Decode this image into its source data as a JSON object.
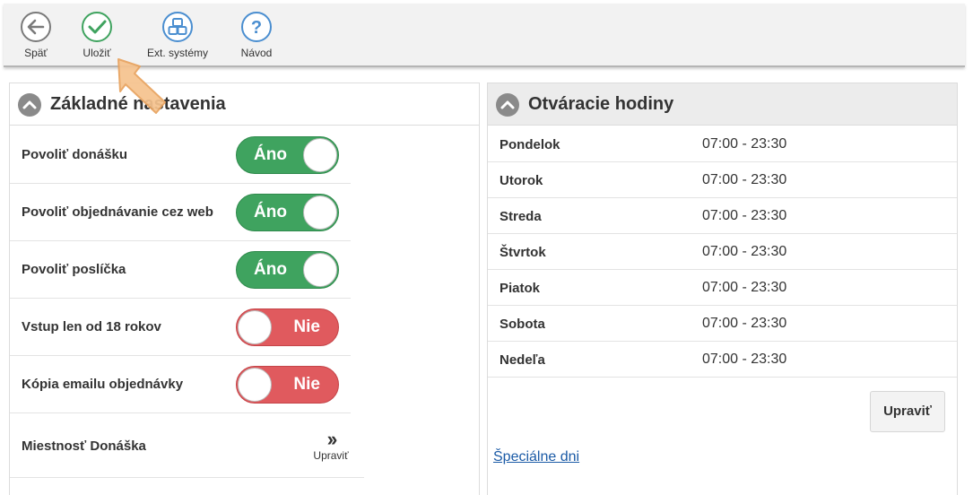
{
  "toolbar": {
    "back_label": "Späť",
    "save_label": "Uložiť",
    "ext_label": "Ext. systémy",
    "help_label": "Návod"
  },
  "left_panel": {
    "title": "Základné nastavenia",
    "settings": [
      {
        "label": "Povoliť donášku",
        "state": "Áno",
        "on": true
      },
      {
        "label": "Povoliť objednávanie cez web",
        "state": "Áno",
        "on": true
      },
      {
        "label": "Povoliť poslíčka",
        "state": "Áno",
        "on": true
      },
      {
        "label": "Vstup len od 18 rokov",
        "state": "Nie",
        "on": false
      },
      {
        "label": "Kópia emailu objednávky",
        "state": "Nie",
        "on": false
      }
    ],
    "room": {
      "label": "Miestnosť Donáška",
      "edit_label": "Upraviť"
    }
  },
  "right_panel": {
    "title": "Otváracie hodiny",
    "hours": [
      {
        "day": "Pondelok",
        "time": "07:00 - 23:30"
      },
      {
        "day": "Utorok",
        "time": "07:00 - 23:30"
      },
      {
        "day": "Streda",
        "time": "07:00 - 23:30"
      },
      {
        "day": "Štvrtok",
        "time": "07:00 - 23:30"
      },
      {
        "day": "Piatok",
        "time": "07:00 - 23:30"
      },
      {
        "day": "Sobota",
        "time": "07:00 - 23:30"
      },
      {
        "day": "Nedeľa",
        "time": "07:00 - 23:30"
      }
    ],
    "edit_label": "Upraviť",
    "special_days_link": "Špeciálne dni"
  },
  "colors": {
    "toggle_on": "#3fa35f",
    "toggle_off": "#e05a5e",
    "link": "#1a5aa6",
    "pointer_arrow": "#f6c38e"
  }
}
